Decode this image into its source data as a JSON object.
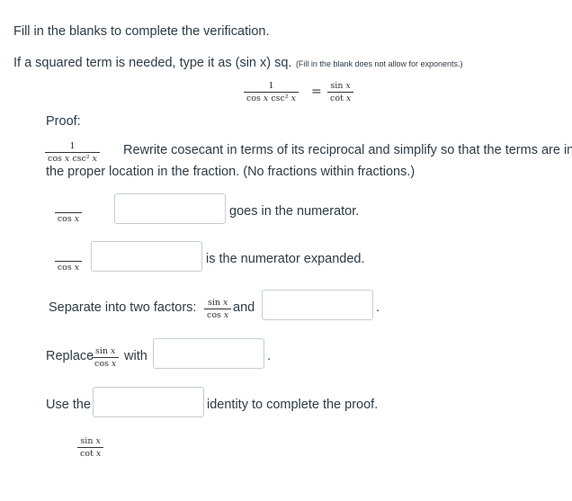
{
  "instructions": {
    "line1": "Fill in the blanks to complete the verification.",
    "line2_main": "If a squared term is needed, type it as (sin x) sq.",
    "line2_note": "(Fill in the blank does not allow for exponents.)"
  },
  "identity": {
    "lhs_numerator": "1",
    "lhs_denominator": "cos 𝑥  csc² 𝑥",
    "equals": "=",
    "rhs_numerator": "sin 𝑥",
    "rhs_denominator": "cot 𝑥"
  },
  "proof": {
    "heading": "Proof:",
    "step1": {
      "numerator": "1",
      "denominator": "cos 𝑥  csc² 𝑥",
      "instruction_line1": "Rewrite cosecant in terms of its reciprocal and simplify so that the terms are in",
      "instruction_line2": "the proper location in the fraction. (No fractions within fractions.)"
    },
    "step2": {
      "denominator": "cos 𝑥",
      "blank_value": "",
      "suffix": "goes in the numerator."
    },
    "step3": {
      "denominator": "cos 𝑥",
      "blank_value": "",
      "suffix": "is the numerator expanded."
    },
    "step4": {
      "prefix": "Separate into two factors:",
      "frac_numerator": "sin 𝑥",
      "frac_denominator": "cos 𝑥",
      "connector": "and",
      "blank_value": "",
      "end": "."
    },
    "step5": {
      "prefix": "Replace",
      "frac_numerator": "sin 𝑥",
      "frac_denominator": "cos 𝑥",
      "connector": "with",
      "blank_value": "",
      "end": "."
    },
    "step6": {
      "prefix": "Use the",
      "blank_value": "",
      "suffix": "identity to complete the proof."
    },
    "final": {
      "numerator": "sin 𝑥",
      "denominator": "cot 𝑥"
    }
  }
}
